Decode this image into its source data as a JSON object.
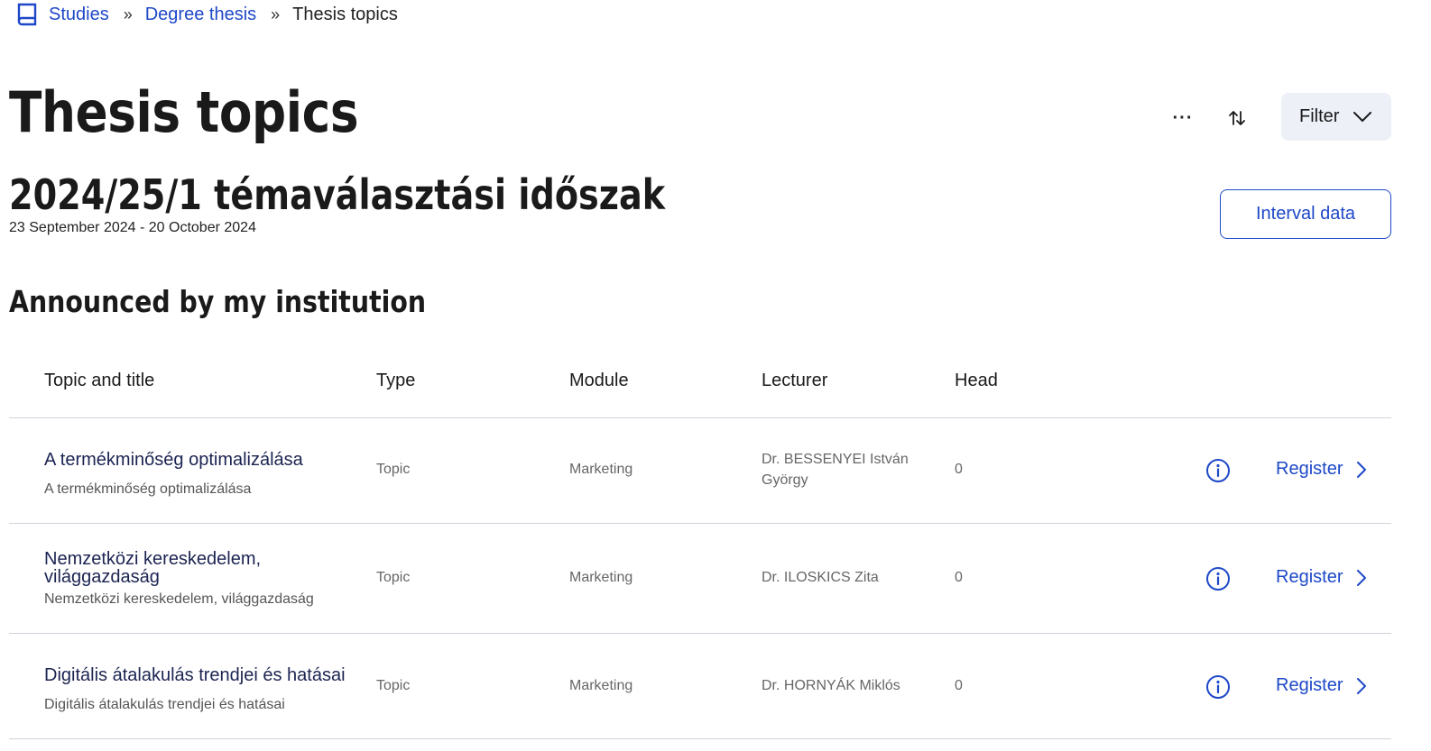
{
  "breadcrumb": {
    "icon": "book-icon",
    "items": [
      {
        "label": "Studies"
      },
      {
        "label": "Degree thesis"
      },
      {
        "label": "Thesis topics"
      }
    ],
    "separator": "»"
  },
  "page": {
    "title": "Thesis topics",
    "more_label": "···",
    "filter_label": "Filter"
  },
  "period": {
    "title": "2024/25/1 témaválasztási időszak",
    "dates": "23 September 2024 - 20 October 2024",
    "interval_button": "Interval data"
  },
  "section": {
    "title": "Announced by my institution"
  },
  "table": {
    "headers": [
      "Topic and title",
      "Type",
      "Module",
      "Lecturer",
      "Head"
    ],
    "rows": [
      {
        "title": "A termékminőség optimalizálása",
        "subtitle": "A termékminőség optimalizálása",
        "type": "Topic",
        "module": "Marketing",
        "lecturer": "Dr. BESSENYEI István György",
        "head": "0",
        "action": "Register"
      },
      {
        "title": "Nemzetközi kereskedelem, világgazdaság",
        "subtitle": "Nemzetközi kereskedelem, világgazdaság",
        "type": "Topic",
        "module": "Marketing",
        "lecturer": "Dr. ILOSKICS Zita",
        "head": "0",
        "action": "Register"
      },
      {
        "title": "Digitális átalakulás trendjei és hatásai",
        "subtitle": "Digitális átalakulás trendjei és hatásai",
        "type": "Topic",
        "module": "Marketing",
        "lecturer": "Dr. HORNYÁK Miklós",
        "head": "0",
        "action": "Register"
      }
    ]
  },
  "colors": {
    "link": "#1e48c8",
    "title_text": "#1c2452",
    "filter_bg": "#eef0f8",
    "divider": "#d0d3db"
  }
}
